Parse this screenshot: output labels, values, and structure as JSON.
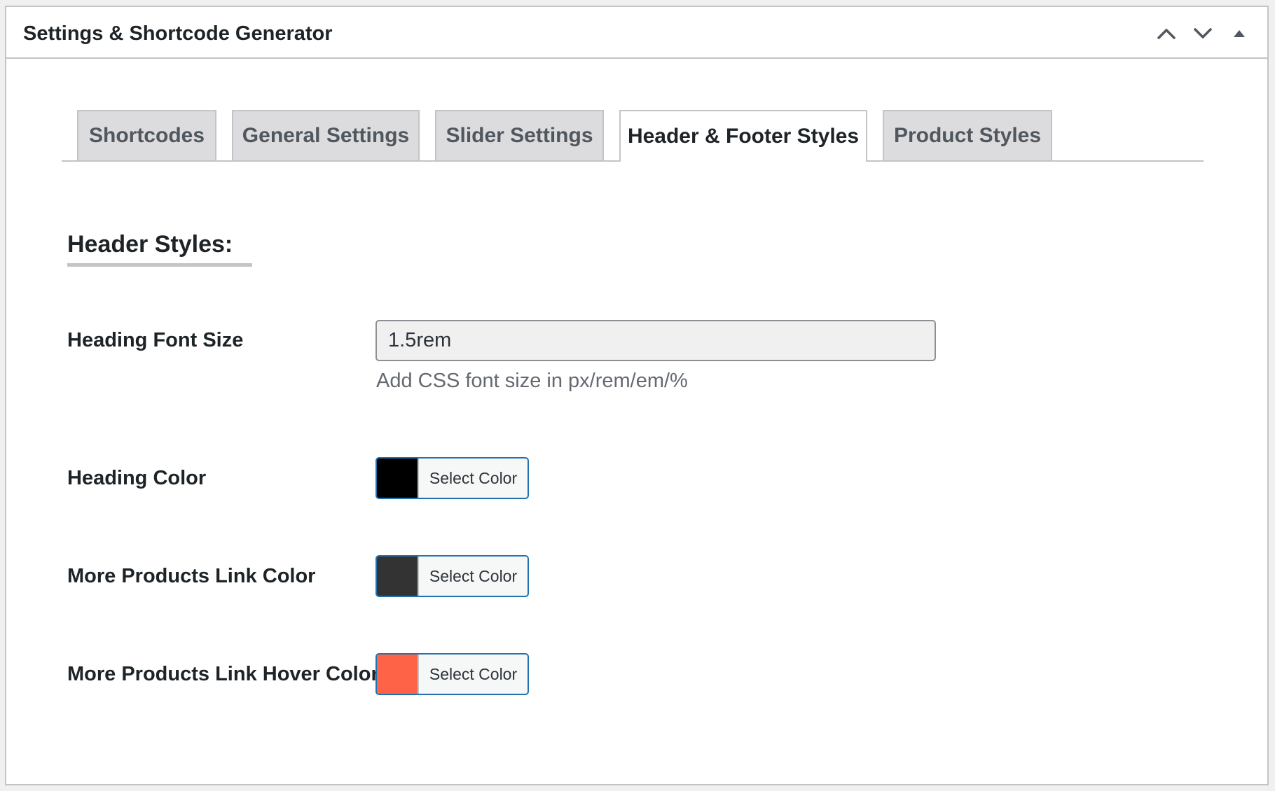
{
  "panel": {
    "title": "Settings & Shortcode Generator",
    "controls": {
      "move_up_icon": "chevron-up-icon",
      "move_down_icon": "chevron-down-icon",
      "toggle_icon": "triangle-up-icon"
    }
  },
  "tabs": [
    {
      "label": "Shortcodes",
      "active": false
    },
    {
      "label": "General Settings",
      "active": false
    },
    {
      "label": "Slider Settings",
      "active": false
    },
    {
      "label": "Header & Footer Styles",
      "active": true
    },
    {
      "label": "Product Styles",
      "active": false
    }
  ],
  "section": {
    "heading": "Header Styles:"
  },
  "fields": {
    "heading_font_size": {
      "label": "Heading Font Size",
      "value": "1.5rem",
      "description": "Add CSS font size in px/rem/em/%"
    },
    "heading_color": {
      "label": "Heading Color",
      "button_label": "Select Color",
      "color": "#000000"
    },
    "more_products_link_color": {
      "label": "More Products Link Color",
      "button_label": "Select Color",
      "color": "#333333"
    },
    "more_products_link_hover_color": {
      "label": "More Products Link Hover Color",
      "button_label": "Select Color",
      "color": "#ff6347"
    }
  },
  "colors": {
    "border": "#c3c4c7",
    "active_border": "#2271b1",
    "inactive_tab_bg": "#dcdcde"
  }
}
